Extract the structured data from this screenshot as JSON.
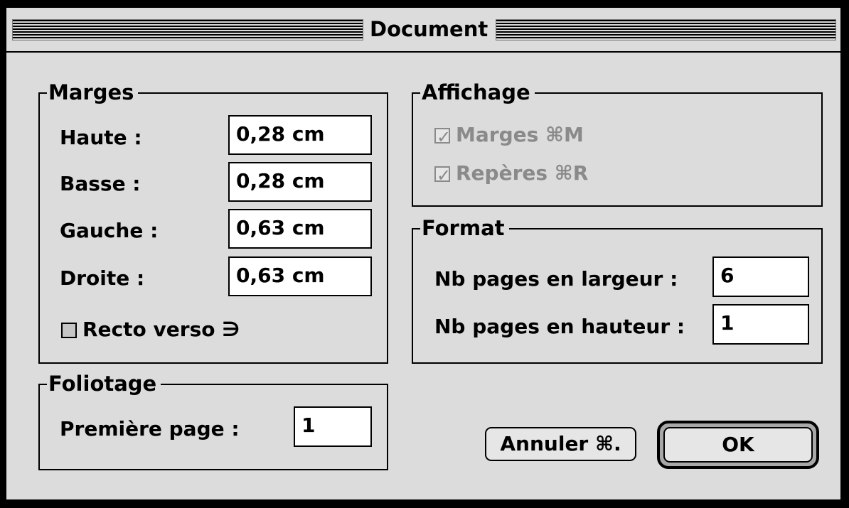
{
  "window": {
    "title": "Document"
  },
  "marges": {
    "title": "Marges",
    "fields": [
      {
        "label": "Haute :",
        "value": "0,28 cm"
      },
      {
        "label": "Basse :",
        "value": "0,28 cm"
      },
      {
        "label": "Gauche :",
        "value": "0,63 cm"
      },
      {
        "label": "Droite :",
        "value": "0,63 cm"
      }
    ],
    "recto_verso": {
      "label": "Recto verso ∋",
      "checked": false
    }
  },
  "affichage": {
    "title": "Affichage",
    "options": [
      {
        "label": "Marges ⌘M",
        "checked": true,
        "enabled": false
      },
      {
        "label": "Repères ⌘R",
        "checked": true,
        "enabled": false
      }
    ]
  },
  "format": {
    "title": "Format",
    "fields": [
      {
        "label": "Nb pages en largeur :",
        "value": "6"
      },
      {
        "label": "Nb pages en hauteur :",
        "value": "1"
      }
    ]
  },
  "foliotage": {
    "title": "Foliotage",
    "first_page_label": "Première page :",
    "first_page_value": "1"
  },
  "buttons": {
    "cancel": "Annuler ⌘.",
    "ok": "OK"
  }
}
